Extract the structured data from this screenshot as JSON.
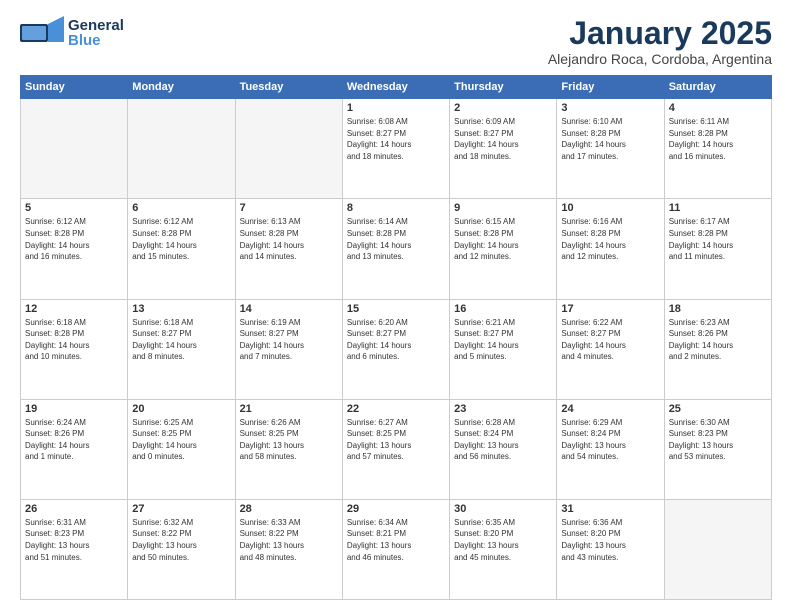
{
  "header": {
    "logo_general": "General",
    "logo_blue": "Blue",
    "month_title": "January 2025",
    "location": "Alejandro Roca, Cordoba, Argentina"
  },
  "weekdays": [
    "Sunday",
    "Monday",
    "Tuesday",
    "Wednesday",
    "Thursday",
    "Friday",
    "Saturday"
  ],
  "weeks": [
    [
      {
        "day": "",
        "info": ""
      },
      {
        "day": "",
        "info": ""
      },
      {
        "day": "",
        "info": ""
      },
      {
        "day": "1",
        "info": "Sunrise: 6:08 AM\nSunset: 8:27 PM\nDaylight: 14 hours\nand 18 minutes."
      },
      {
        "day": "2",
        "info": "Sunrise: 6:09 AM\nSunset: 8:27 PM\nDaylight: 14 hours\nand 18 minutes."
      },
      {
        "day": "3",
        "info": "Sunrise: 6:10 AM\nSunset: 8:28 PM\nDaylight: 14 hours\nand 17 minutes."
      },
      {
        "day": "4",
        "info": "Sunrise: 6:11 AM\nSunset: 8:28 PM\nDaylight: 14 hours\nand 16 minutes."
      }
    ],
    [
      {
        "day": "5",
        "info": "Sunrise: 6:12 AM\nSunset: 8:28 PM\nDaylight: 14 hours\nand 16 minutes."
      },
      {
        "day": "6",
        "info": "Sunrise: 6:12 AM\nSunset: 8:28 PM\nDaylight: 14 hours\nand 15 minutes."
      },
      {
        "day": "7",
        "info": "Sunrise: 6:13 AM\nSunset: 8:28 PM\nDaylight: 14 hours\nand 14 minutes."
      },
      {
        "day": "8",
        "info": "Sunrise: 6:14 AM\nSunset: 8:28 PM\nDaylight: 14 hours\nand 13 minutes."
      },
      {
        "day": "9",
        "info": "Sunrise: 6:15 AM\nSunset: 8:28 PM\nDaylight: 14 hours\nand 12 minutes."
      },
      {
        "day": "10",
        "info": "Sunrise: 6:16 AM\nSunset: 8:28 PM\nDaylight: 14 hours\nand 12 minutes."
      },
      {
        "day": "11",
        "info": "Sunrise: 6:17 AM\nSunset: 8:28 PM\nDaylight: 14 hours\nand 11 minutes."
      }
    ],
    [
      {
        "day": "12",
        "info": "Sunrise: 6:18 AM\nSunset: 8:28 PM\nDaylight: 14 hours\nand 10 minutes."
      },
      {
        "day": "13",
        "info": "Sunrise: 6:18 AM\nSunset: 8:27 PM\nDaylight: 14 hours\nand 8 minutes."
      },
      {
        "day": "14",
        "info": "Sunrise: 6:19 AM\nSunset: 8:27 PM\nDaylight: 14 hours\nand 7 minutes."
      },
      {
        "day": "15",
        "info": "Sunrise: 6:20 AM\nSunset: 8:27 PM\nDaylight: 14 hours\nand 6 minutes."
      },
      {
        "day": "16",
        "info": "Sunrise: 6:21 AM\nSunset: 8:27 PM\nDaylight: 14 hours\nand 5 minutes."
      },
      {
        "day": "17",
        "info": "Sunrise: 6:22 AM\nSunset: 8:27 PM\nDaylight: 14 hours\nand 4 minutes."
      },
      {
        "day": "18",
        "info": "Sunrise: 6:23 AM\nSunset: 8:26 PM\nDaylight: 14 hours\nand 2 minutes."
      }
    ],
    [
      {
        "day": "19",
        "info": "Sunrise: 6:24 AM\nSunset: 8:26 PM\nDaylight: 14 hours\nand 1 minute."
      },
      {
        "day": "20",
        "info": "Sunrise: 6:25 AM\nSunset: 8:25 PM\nDaylight: 14 hours\nand 0 minutes."
      },
      {
        "day": "21",
        "info": "Sunrise: 6:26 AM\nSunset: 8:25 PM\nDaylight: 13 hours\nand 58 minutes."
      },
      {
        "day": "22",
        "info": "Sunrise: 6:27 AM\nSunset: 8:25 PM\nDaylight: 13 hours\nand 57 minutes."
      },
      {
        "day": "23",
        "info": "Sunrise: 6:28 AM\nSunset: 8:24 PM\nDaylight: 13 hours\nand 56 minutes."
      },
      {
        "day": "24",
        "info": "Sunrise: 6:29 AM\nSunset: 8:24 PM\nDaylight: 13 hours\nand 54 minutes."
      },
      {
        "day": "25",
        "info": "Sunrise: 6:30 AM\nSunset: 8:23 PM\nDaylight: 13 hours\nand 53 minutes."
      }
    ],
    [
      {
        "day": "26",
        "info": "Sunrise: 6:31 AM\nSunset: 8:23 PM\nDaylight: 13 hours\nand 51 minutes."
      },
      {
        "day": "27",
        "info": "Sunrise: 6:32 AM\nSunset: 8:22 PM\nDaylight: 13 hours\nand 50 minutes."
      },
      {
        "day": "28",
        "info": "Sunrise: 6:33 AM\nSunset: 8:22 PM\nDaylight: 13 hours\nand 48 minutes."
      },
      {
        "day": "29",
        "info": "Sunrise: 6:34 AM\nSunset: 8:21 PM\nDaylight: 13 hours\nand 46 minutes."
      },
      {
        "day": "30",
        "info": "Sunrise: 6:35 AM\nSunset: 8:20 PM\nDaylight: 13 hours\nand 45 minutes."
      },
      {
        "day": "31",
        "info": "Sunrise: 6:36 AM\nSunset: 8:20 PM\nDaylight: 13 hours\nand 43 minutes."
      },
      {
        "day": "",
        "info": ""
      }
    ]
  ]
}
